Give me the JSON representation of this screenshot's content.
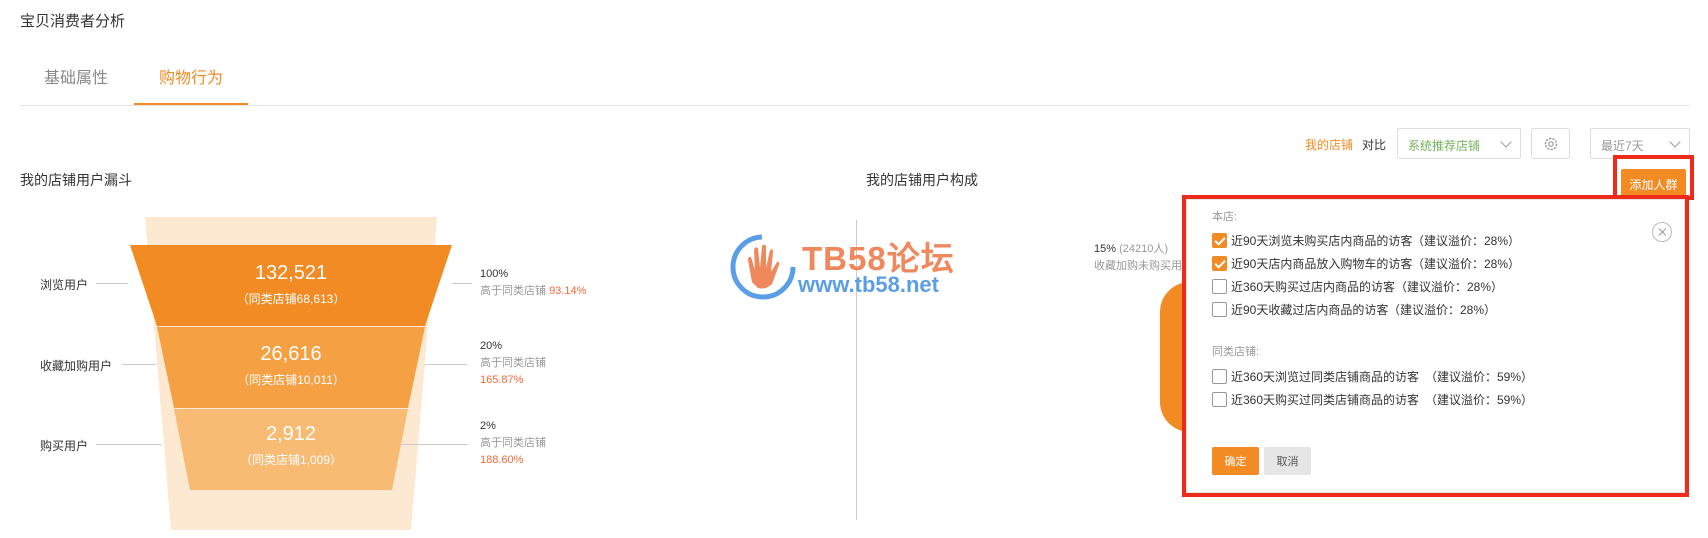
{
  "page_title": "宝贝消费者分析",
  "tabs": [
    {
      "label": "基础属性",
      "active": false
    },
    {
      "label": "购物行为",
      "active": true
    }
  ],
  "compare": {
    "my_store_label": "我的店铺",
    "vs_label": "对比",
    "compare_select_value": "系统推荐店铺",
    "period_select_value": "最近7天",
    "settings_icon": "gear-icon"
  },
  "funnel": {
    "title": "我的店铺用户漏斗",
    "stages": [
      {
        "label": "浏览用户",
        "value": "132,521",
        "peer": "（同类店铺68,613）",
        "rate": "100%",
        "compare_text": "高于同类店铺",
        "compare_pct": "93.14%"
      },
      {
        "label": "收藏加购用户",
        "value": "26,616",
        "peer": "（同类店铺10,011）",
        "rate": "20%",
        "compare_text": "高于同类店铺",
        "compare_pct": "165.87%"
      },
      {
        "label": "购买用户",
        "value": "2,912",
        "peer": "（同类店铺1,009）",
        "rate": "2%",
        "compare_text": "高于同类店铺",
        "compare_pct": "188.60%"
      }
    ],
    "colors": {
      "top": "#f28b24",
      "mid": "#f5a043",
      "low": "#f8bb73",
      "bg": "#fde8d2"
    }
  },
  "composition": {
    "title": "我的店铺用户构成",
    "stat_pct": "15%",
    "stat_count": "(24210人)",
    "stat_label": "收藏加购未购买用"
  },
  "add_group_button": "添加人群",
  "watermark": {
    "main": "TB58论坛",
    "url": "www.tb58.net"
  },
  "popup": {
    "own_store_heading": "本店:",
    "own_store_options": [
      {
        "label": "近90天浏览未购买店内商品的访客",
        "premium": "（建议溢价：28%）",
        "checked": true
      },
      {
        "label": "近90天店内商品放入购物车的访客",
        "premium": "（建议溢价：28%）",
        "checked": true
      },
      {
        "label": "近360天购买过店内商品的访客",
        "premium": "（建议溢价：28%）",
        "checked": false
      },
      {
        "label": "近90天收藏过店内商品的访客",
        "premium": "（建议溢价：28%）",
        "checked": false
      }
    ],
    "peer_store_heading": "同类店铺:",
    "peer_store_options": [
      {
        "label": "近360天浏览过同类店铺商品的访客",
        "premium": "（建议溢价：59%）",
        "checked": false
      },
      {
        "label": "近360天购买过同类店铺商品的访客",
        "premium": "（建议溢价：59%）",
        "checked": false
      }
    ],
    "confirm_label": "确定",
    "cancel_label": "取消"
  },
  "accent_color": "#f28b24",
  "highlight_color": "#ee2a1b"
}
